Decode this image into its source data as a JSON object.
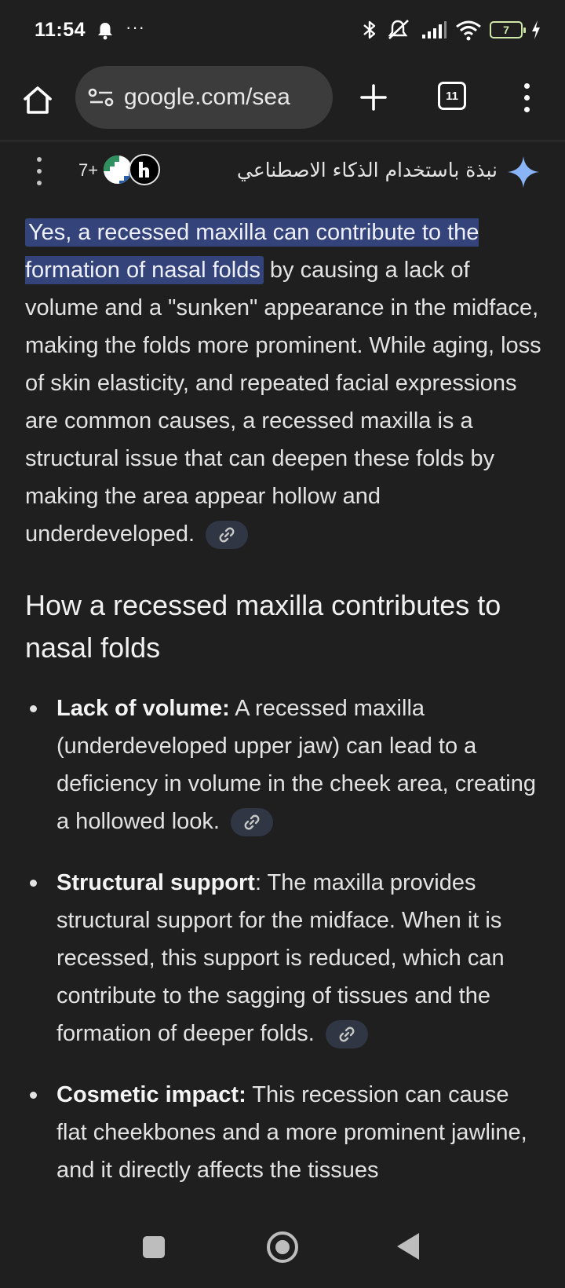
{
  "status_bar": {
    "time": "11:54",
    "dots": "···",
    "battery": "7"
  },
  "toolbar": {
    "url": "google.com/sea",
    "tab_count": "11"
  },
  "ai_overview": {
    "title": "نبذة باستخدام الذكاء الاصطناعي",
    "sources_count": "7+",
    "accent_color": "#8ab4f8",
    "highlight_color": "#34447a"
  },
  "content": {
    "intro_highlight": "Yes, a recessed maxilla can contribute to the formation of nasal folds",
    "intro_rest": " by causing a lack of volume and a \"sunken\" appearance in the midface, making the folds more prominent. While aging, loss of skin elasticity, and repeated facial expressions are common causes, a recessed maxilla is a structural issue that can deepen these folds by making the area appear hollow and underdeveloped.",
    "heading": "How a recessed maxilla contributes to nasal folds",
    "bullets": [
      {
        "term": "Lack of volume:",
        "text": " A recessed maxilla (underdeveloped upper jaw) can lead to a deficiency in volume in the cheek area, creating a hollowed look."
      },
      {
        "term": "Structural support",
        "text": ": The maxilla provides structural support for the midface. When it is recessed, this support is reduced, which can contribute to the sagging of tissues and the formation of deeper folds."
      },
      {
        "term": "Cosmetic impact:",
        "text": " This recession can cause flat cheekbones and a more prominent jawline, and it directly affects the tissues"
      }
    ]
  },
  "icons": {
    "home": "home-icon",
    "site_settings": "tune-icon",
    "new_tab": "plus-icon",
    "menu": "more-vert-icon",
    "sparkle": "gemini-sparkle-icon",
    "link": "link-icon"
  }
}
